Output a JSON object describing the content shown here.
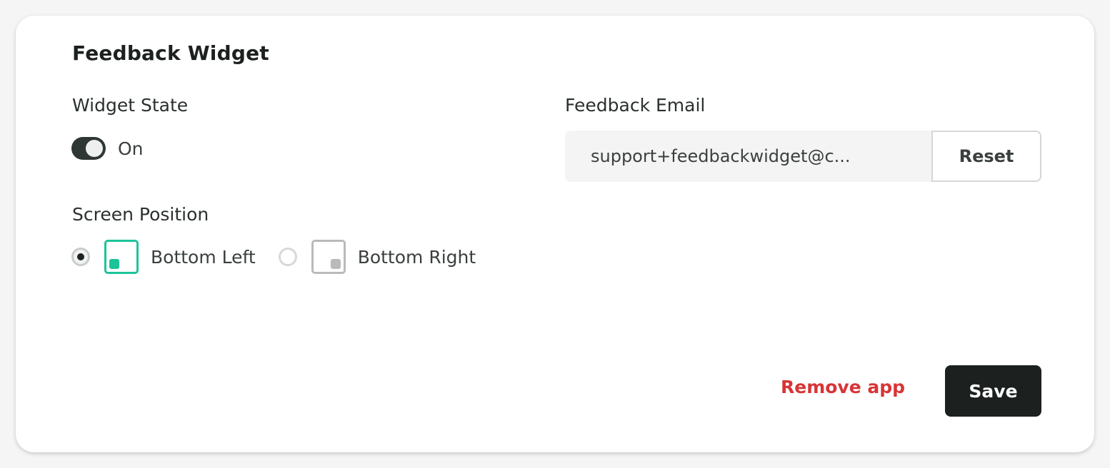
{
  "card": {
    "title": "Feedback Widget"
  },
  "widget_state": {
    "label": "Widget State",
    "toggle_on": true,
    "toggle_text": "On"
  },
  "screen_position": {
    "label": "Screen Position",
    "selected": "Bottom Left",
    "options": [
      {
        "label": "Bottom Left",
        "icon": "bottom-left-position-icon",
        "checked": true
      },
      {
        "label": "Bottom Right",
        "icon": "bottom-right-position-icon",
        "checked": false
      }
    ]
  },
  "feedback_email": {
    "label": "Feedback Email",
    "value": "support+feedbackwidget@c...",
    "reset_label": "Reset"
  },
  "footer": {
    "remove_label": "Remove app",
    "save_label": "Save"
  },
  "colors": {
    "accent": "#1dc39a",
    "danger": "#d83436",
    "primary_button": "#1c2120"
  }
}
